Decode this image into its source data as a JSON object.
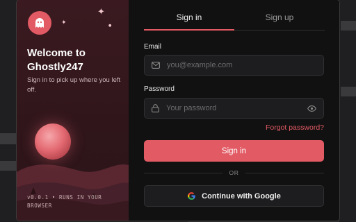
{
  "brand": {
    "welcome_title": "Welcome to Ghostly247",
    "subtitle": "Sign in to pick up where you left off.",
    "version_note": "v0.0.1 • RUNS IN YOUR BROWSER",
    "accent_color": "#e25a64"
  },
  "tabs": [
    {
      "label": "Sign in",
      "active": true
    },
    {
      "label": "Sign up",
      "active": false
    }
  ],
  "form": {
    "email": {
      "label": "Email",
      "placeholder": "you@example.com",
      "value": ""
    },
    "password": {
      "label": "Password",
      "placeholder": "Your password",
      "value": ""
    },
    "forgot_label": "Forgot password?",
    "submit_label": "Sign in",
    "divider_label": "OR",
    "google_label": "Continue with Google"
  },
  "icons": {
    "logo": "ghost-icon",
    "email": "mail-icon",
    "password": "lock-icon",
    "reveal": "eye-icon",
    "google": "google-icon"
  }
}
